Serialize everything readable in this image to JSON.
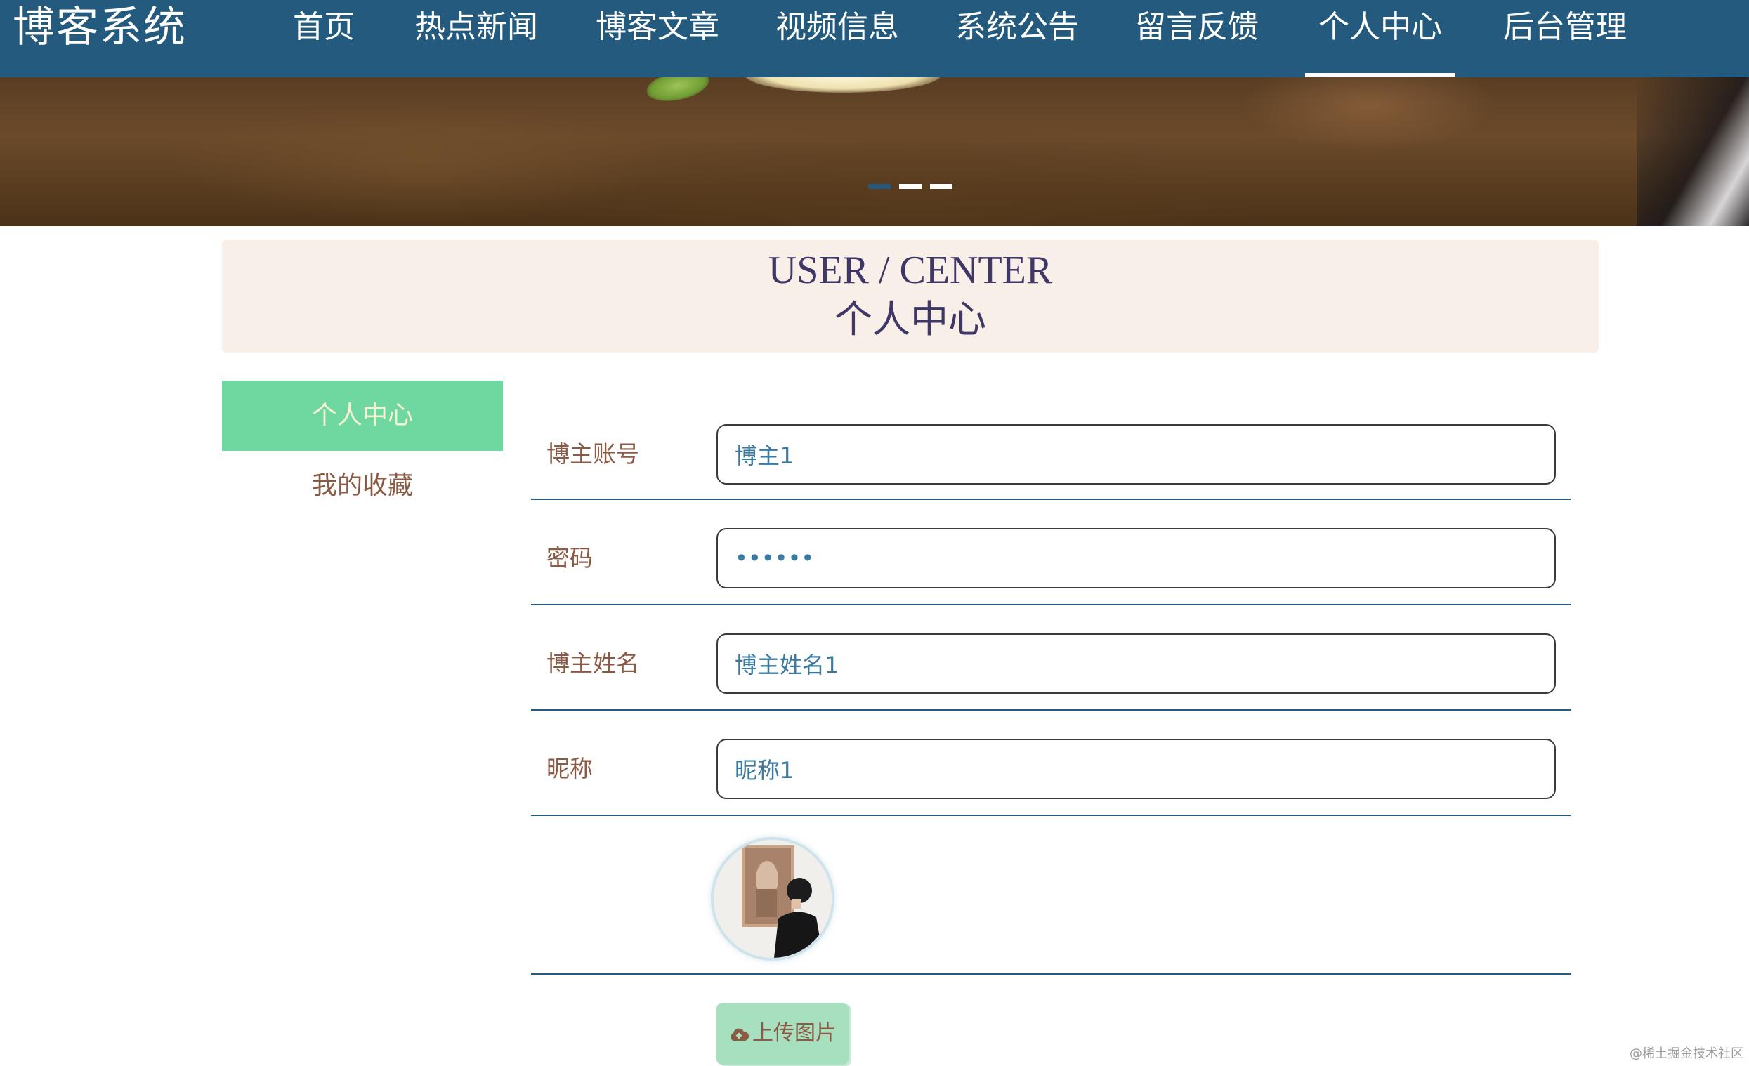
{
  "brand": "博客系统",
  "nav": {
    "items": [
      {
        "label": "首页"
      },
      {
        "label": "热点新闻"
      },
      {
        "label": "博客文章"
      },
      {
        "label": "视频信息"
      },
      {
        "label": "系统公告"
      },
      {
        "label": "留言反馈"
      },
      {
        "label": "个人中心",
        "active": true
      },
      {
        "label": "后台管理"
      }
    ]
  },
  "banner": {
    "dots": 3,
    "active_dot": 0
  },
  "section": {
    "title_en": "USER / CENTER",
    "title_cn": "个人中心"
  },
  "sidebar": {
    "items": [
      {
        "label": "个人中心",
        "active": true
      },
      {
        "label": "我的收藏"
      }
    ]
  },
  "form": {
    "account": {
      "label": "博主账号",
      "value": "博主1"
    },
    "password": {
      "label": "密码",
      "value": "123456"
    },
    "name": {
      "label": "博主姓名",
      "value": "博主姓名1"
    },
    "nickname": {
      "label": "昵称",
      "value": "昵称1"
    },
    "upload_label": "上传图片"
  },
  "colors": {
    "nav_bg": "#245a7d",
    "sidebar_active": "#6ed8a0",
    "upload_btn": "#a6e0bf",
    "title_bg": "#f8efe9",
    "label_text": "#8a5a44",
    "input_text": "#3a79a0"
  },
  "icons": {
    "upload": "cloud-upload-icon"
  },
  "watermark": "@稀土掘金技术社区"
}
